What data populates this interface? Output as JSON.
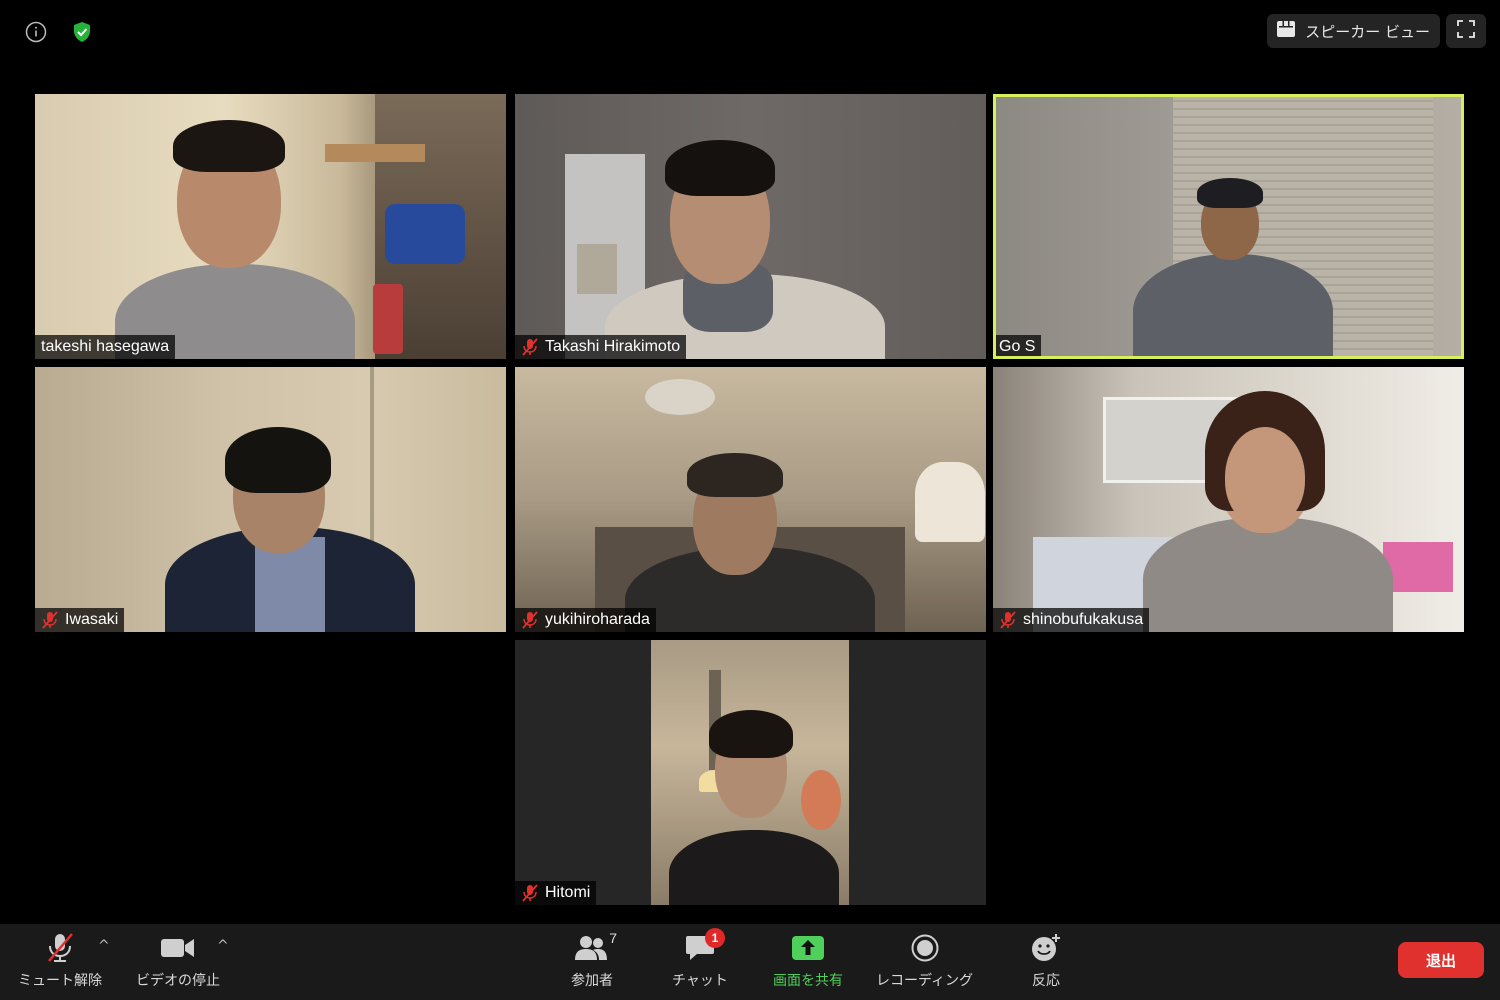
{
  "top_bar": {
    "info_icon": "info-icon",
    "security_icon": "shield-check-icon",
    "view_label": "スピーカー ビュー",
    "view_icon": "grid-icon",
    "fullscreen_icon": "fullscreen-icon"
  },
  "participants": [
    {
      "name": "takeshi hasegawa",
      "muted": false,
      "active": false
    },
    {
      "name": "Takashi Hirakimoto",
      "muted": true,
      "active": false
    },
    {
      "name": "Go S",
      "muted": false,
      "active": true
    },
    {
      "name": "Iwasaki",
      "muted": true,
      "active": false
    },
    {
      "name": "yukihiroharada",
      "muted": true,
      "active": false
    },
    {
      "name": "shinobufukakusa",
      "muted": true,
      "active": false
    },
    {
      "name": "Hitomi",
      "muted": true,
      "active": false
    }
  ],
  "toolbar": {
    "mute_label": "ミュート解除",
    "video_label": "ビデオの停止",
    "participants_label": "参加者",
    "participants_count": "7",
    "chat_label": "チャット",
    "chat_badge": "1",
    "share_label": "画面を共有",
    "record_label": "レコーディング",
    "reactions_label": "反応",
    "leave_label": "退出"
  },
  "colors": {
    "active_border": "#d7ef5b",
    "share_green": "#4fd05a",
    "leave_red": "#e0312f",
    "muted_red": "#e0312f"
  }
}
